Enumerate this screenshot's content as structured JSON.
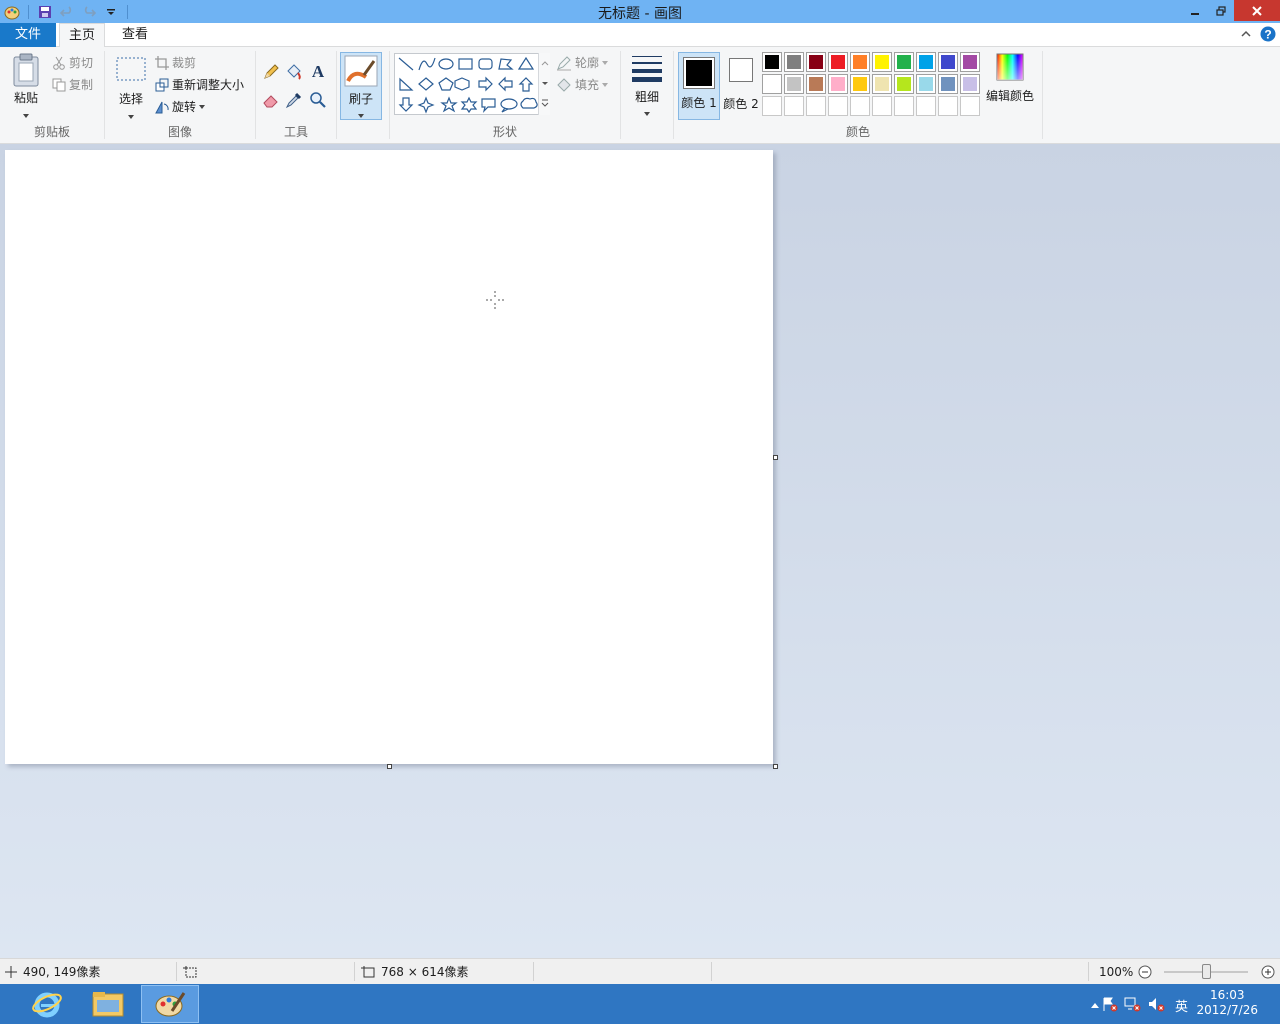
{
  "window": {
    "title": "无标题 - 画图"
  },
  "tabs": {
    "file": "文件",
    "home": "主页",
    "view": "查看"
  },
  "clipboard": {
    "paste": "粘贴",
    "cut": "剪切",
    "copy": "复制",
    "label": "剪贴板"
  },
  "image": {
    "select": "选择",
    "crop": "裁剪",
    "resize": "重新调整大小",
    "rotate": "旋转",
    "label": "图像"
  },
  "tools": {
    "label": "工具"
  },
  "brushes": {
    "label": "刷子"
  },
  "shapes": {
    "outline": "轮廓",
    "fill": "填充",
    "label": "形状"
  },
  "size": {
    "label": "粗细"
  },
  "colors": {
    "color1": "颜色 1",
    "color2": "颜色 2",
    "edit": "编辑颜色",
    "label": "颜色",
    "color1_value": "#000000",
    "color2_value": "#ffffff",
    "palette_row1": [
      "#000000",
      "#7f7f7f",
      "#880015",
      "#ed1c24",
      "#ff7f27",
      "#fff200",
      "#22b14c",
      "#00a2e8",
      "#3f48cc",
      "#a349a4"
    ],
    "palette_row2": [
      "#ffffff",
      "#c3c3c3",
      "#b97a57",
      "#ffaec9",
      "#ffc90e",
      "#efe4b0",
      "#b5e61d",
      "#99d9ea",
      "#7092be",
      "#c8bfe7"
    ],
    "palette_row3": [
      "#ffffff",
      "#ffffff",
      "#ffffff",
      "#ffffff",
      "#ffffff",
      "#ffffff",
      "#ffffff",
      "#ffffff",
      "#ffffff",
      "#ffffff"
    ]
  },
  "status": {
    "cursor_pos": "490, 149像素",
    "canvas_size": "768 × 614像素",
    "zoom": "100%"
  },
  "taskbar": {
    "time": "16:03",
    "date": "2012/7/26",
    "ime": "英"
  }
}
